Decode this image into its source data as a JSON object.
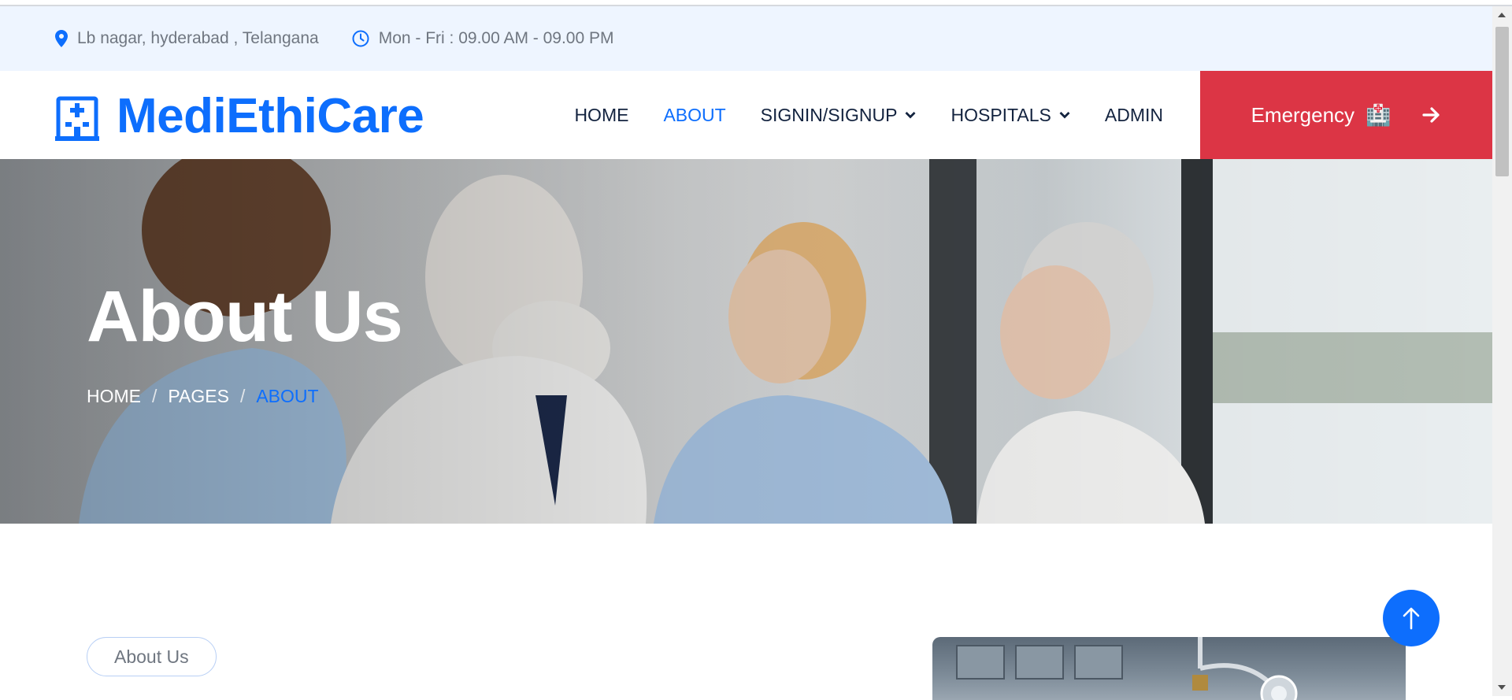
{
  "topbar": {
    "address": "Lb nagar, hyderabad , Telangana",
    "hours": "Mon - Fri : 09.00 AM - 09.00 PM",
    "icons": [
      "map-pin-icon",
      "clock-icon"
    ]
  },
  "brand": {
    "name": "MediEthiCare",
    "icon": "hospital-building-icon"
  },
  "nav": {
    "items": [
      {
        "label": "HOME",
        "active": false,
        "dropdown": false
      },
      {
        "label": "ABOUT",
        "active": true,
        "dropdown": false
      },
      {
        "label": "SIGNIN/SIGNUP",
        "active": false,
        "dropdown": true
      },
      {
        "label": "HOSPITALS",
        "active": false,
        "dropdown": true
      },
      {
        "label": "ADMIN",
        "active": false,
        "dropdown": false
      }
    ],
    "emergency_label": "Emergency",
    "emergency_emoji": "🏥"
  },
  "hero": {
    "title": "About Us",
    "breadcrumbs": [
      "HOME",
      "PAGES",
      "ABOUT"
    ],
    "separator": "/"
  },
  "content": {
    "badge": "About Us"
  },
  "colors": {
    "primary": "#0d6efd",
    "emergency": "#dc3545",
    "topbar_bg": "#eef5ff",
    "nav_text": "#13233f"
  }
}
